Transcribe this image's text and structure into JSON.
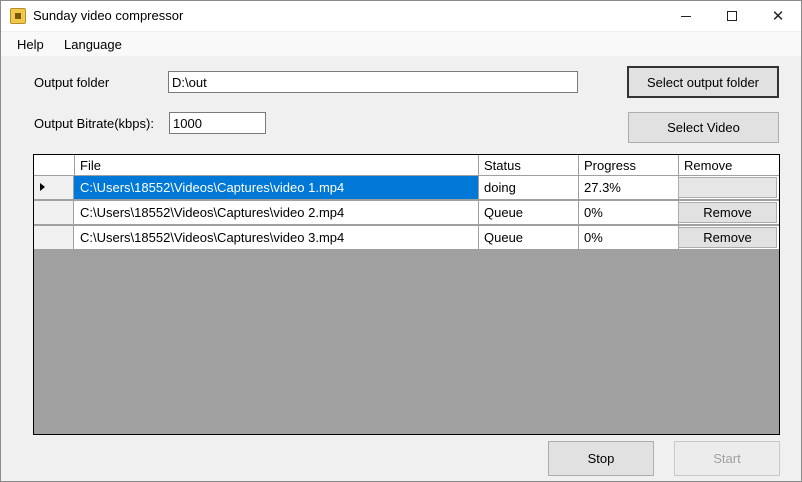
{
  "window": {
    "title": "Sunday video compressor",
    "icon": "app-icon",
    "controls": {
      "minimize": "minimize-icon",
      "maximize": "maximize-icon",
      "close": "✕"
    }
  },
  "menu": {
    "items": [
      "Help",
      "Language"
    ]
  },
  "settings": {
    "output_folder_label": "Output folder",
    "output_folder_value": "D:\\out",
    "bitrate_label": "Output Bitrate(kbps):",
    "bitrate_value": "1000"
  },
  "buttons": {
    "select_output_folder": "Select output folder",
    "select_video": "Select Video",
    "stop": "Stop",
    "start": "Start"
  },
  "grid": {
    "headers": {
      "file": "File",
      "status": "Status",
      "progress": "Progress",
      "remove": "Remove"
    },
    "rows": [
      {
        "file": "C:\\Users\\18552\\Videos\\Captures\\video 1.mp4",
        "status": "doing",
        "progress": "27.3%",
        "remove": ""
      },
      {
        "file": "C:\\Users\\18552\\Videos\\Captures\\video 2.mp4",
        "status": "Queue",
        "progress": "0%",
        "remove": "Remove"
      },
      {
        "file": "C:\\Users\\18552\\Videos\\Captures\\video 3.mp4",
        "status": "Queue",
        "progress": "0%",
        "remove": "Remove"
      }
    ]
  },
  "colors": {
    "selection": "#0078d7",
    "grid_background": "#a0a0a0"
  }
}
